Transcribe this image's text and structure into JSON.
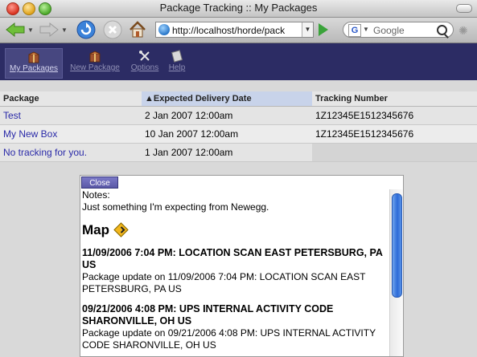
{
  "window": {
    "title": "Package Tracking :: My Packages"
  },
  "browser": {
    "url": "http://localhost/horde/pack",
    "search_engine": "Google",
    "search_placeholder": "Google"
  },
  "nav": [
    {
      "label": "My Packages",
      "active": true
    },
    {
      "label": "New Package",
      "active": false
    },
    {
      "label": "Options",
      "active": false
    },
    {
      "label": "Help",
      "active": false
    }
  ],
  "table": {
    "headers": [
      "Package",
      "▲Expected Delivery Date",
      "Tracking Number"
    ],
    "rows": [
      [
        "Test",
        "2 Jan 2007 12:00am",
        "1Z12345E1512345676"
      ],
      [
        "My New Box",
        "10 Jan 2007 12:00am",
        "1Z12345E1512345676"
      ],
      [
        "No tracking for you.",
        "1 Jan 2007 12:00am",
        ""
      ]
    ]
  },
  "popup": {
    "close_label": "Close",
    "notes_label": "Notes:",
    "notes_text": "Just something I'm expecting from Newegg.",
    "map_heading": "Map",
    "events": [
      {
        "title": "11/09/2006 7:04 PM: LOCATION SCAN EAST PETERSBURG, PA US",
        "desc": "Package update on 11/09/2006 7:04 PM: LOCATION SCAN EAST PETERSBURG, PA US"
      },
      {
        "title": "09/21/2006 4:08 PM: UPS INTERNAL ACTIVITY CODE SHARONVILLE, OH US",
        "desc": "Package update on 09/21/2006 4:08 PM: UPS INTERNAL ACTIVITY CODE SHARONVILLE, OH US"
      }
    ]
  }
}
